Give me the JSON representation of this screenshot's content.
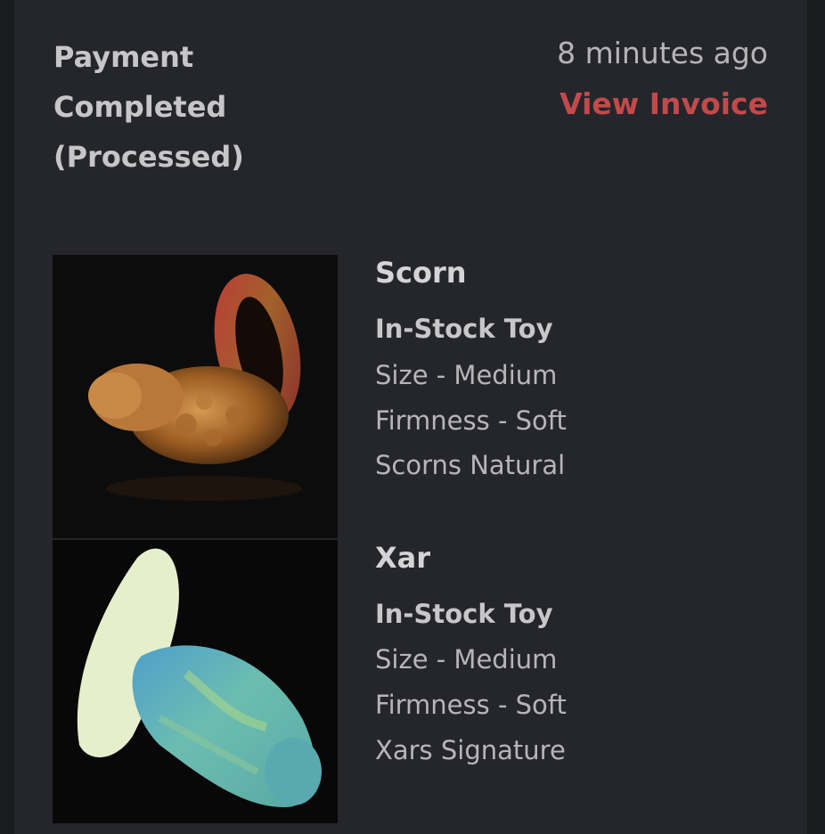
{
  "header": {
    "status": "Payment\nCompleted\n(Processed)",
    "time": "8 minutes ago",
    "invoice_link": "View Invoice"
  },
  "items": [
    {
      "name": "Scorn",
      "type": "In-Stock Toy",
      "size": "Size - Medium",
      "firmness": "Firmness - Soft",
      "color": "Scorns Natural",
      "image_icon": "product-photo-scorn"
    },
    {
      "name": "Xar",
      "type": "In-Stock Toy",
      "size": "Size - Medium",
      "firmness": "Firmness - Soft",
      "color": "Xars Signature",
      "image_icon": "product-photo-xar"
    }
  ],
  "colors": {
    "background": "#1a1b1f",
    "card": "#25262c",
    "accent": "#c24a4a",
    "text": "#c6c6c9"
  }
}
